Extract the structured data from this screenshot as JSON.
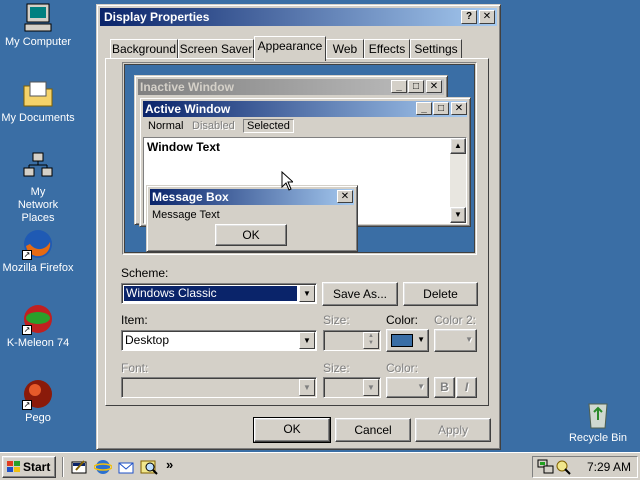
{
  "desktop": {
    "icons": [
      {
        "label": "My Computer",
        "icon": "my-computer-icon"
      },
      {
        "label": "My Documents",
        "icon": "my-documents-icon"
      },
      {
        "label": "My Network Places",
        "icon": "network-places-icon"
      },
      {
        "label": "Mozilla Firefox",
        "icon": "firefox-icon"
      },
      {
        "label": "K-Meleon 74",
        "icon": "k-meleon-icon"
      },
      {
        "label": "Pego",
        "icon": "pego-icon"
      },
      {
        "label": "Recycle Bin",
        "icon": "recycle-bin-icon"
      }
    ],
    "background_color": "#3a6ea5"
  },
  "dialog": {
    "title": "Display Properties",
    "help_button": "?",
    "close_button": "✕",
    "tabs": [
      {
        "label": "Background"
      },
      {
        "label": "Screen Saver"
      },
      {
        "label": "Appearance",
        "active": true
      },
      {
        "label": "Web"
      },
      {
        "label": "Effects"
      },
      {
        "label": "Settings"
      }
    ],
    "preview": {
      "inactive_title": "Inactive Window",
      "active_title": "Active Window",
      "menu": {
        "normal": "Normal",
        "disabled": "Disabled",
        "selected": "Selected"
      },
      "window_text": "Window Text",
      "message_box_title": "Message Box",
      "message_text": "Message Text",
      "ok": "OK"
    },
    "scheme": {
      "label": "Scheme:",
      "value": "Windows Classic",
      "save_as": "Save As...",
      "delete": "Delete"
    },
    "item": {
      "label": "Item:",
      "value": "Desktop",
      "size_label": "Size:",
      "color_label": "Color:",
      "color2_label": "Color 2:",
      "color_value": "#3a6ea5"
    },
    "font": {
      "label": "Font:",
      "size_label": "Size:",
      "color_label": "Color:",
      "bold": "B",
      "italic": "I"
    },
    "buttons": {
      "ok": "OK",
      "cancel": "Cancel",
      "apply": "Apply"
    }
  },
  "taskbar": {
    "start": "Start",
    "chevron": "»",
    "clock": "7:29 AM"
  },
  "colors": {
    "active_title_start": "#0a246a",
    "active_title_end": "#a6caf0",
    "inactive_title_start": "#808080",
    "inactive_title_end": "#c0c0c0",
    "face": "#d4d0c8"
  }
}
